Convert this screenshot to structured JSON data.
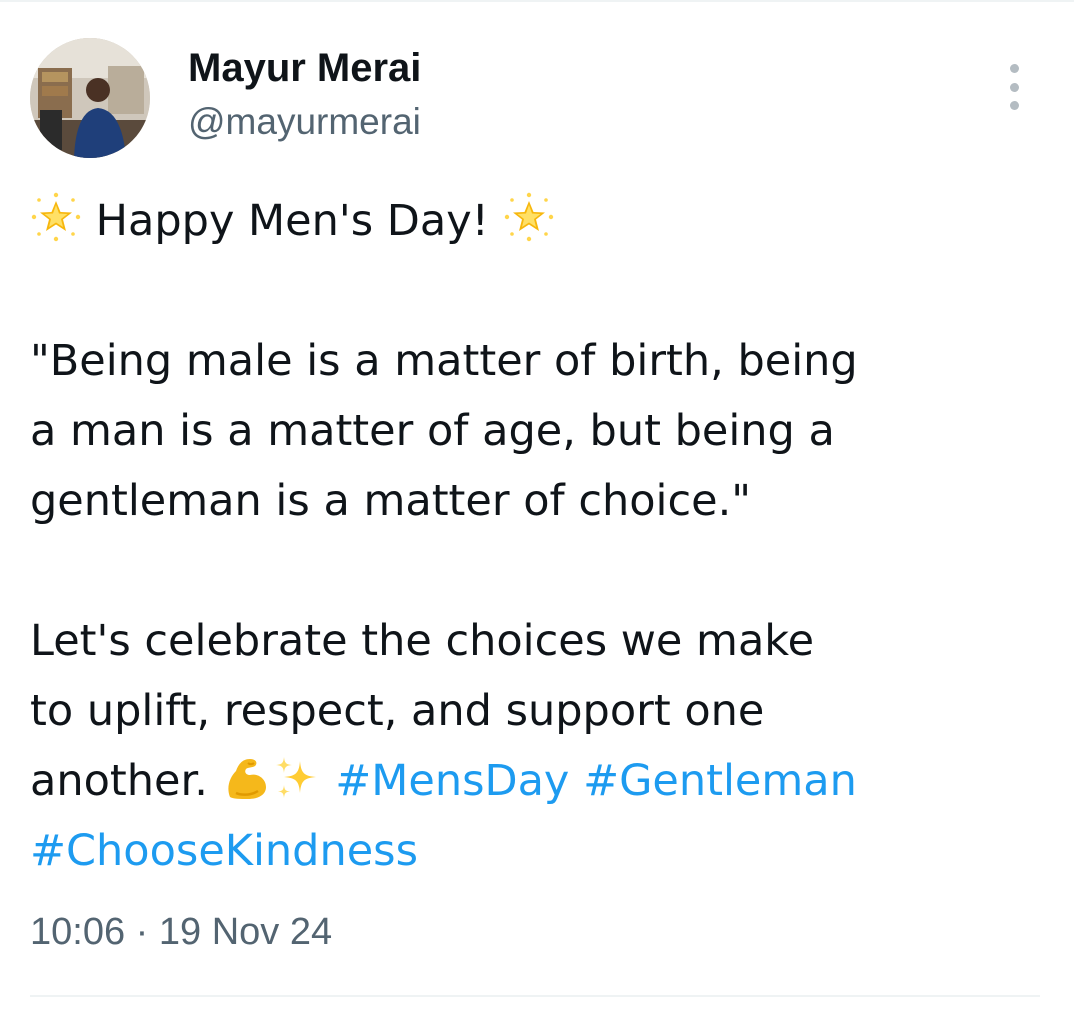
{
  "author": {
    "display_name": "Mayur Merai",
    "handle": "@mayurmerai",
    "avatar_icon": "profile-photo-avatar"
  },
  "menu": {
    "icon": "more-vertical-icon"
  },
  "tweet": {
    "line1_text": "Happy Men's Day!",
    "line1_emoji": "glowing-star",
    "quote_line1": "\"Being male is a matter of birth, being",
    "quote_line2": "a man is a matter of age, but being a",
    "quote_line3": "gentleman is a matter of choice.\"",
    "body_line1": "Let's celebrate the choices we make",
    "body_line2": "to uplift, respect, and support one",
    "body_line3": "another.",
    "body_emojis": [
      "flexed-biceps",
      "sparkles"
    ],
    "hashtags": [
      "#MensDay",
      "#Gentleman",
      "#ChooseKindness"
    ]
  },
  "meta": {
    "timestamp": "10:06 · 19 Nov 24"
  },
  "colors": {
    "text": "#0f1419",
    "secondary": "#536471",
    "hashtag": "#1d9bf0",
    "divider": "#eff3f4"
  }
}
